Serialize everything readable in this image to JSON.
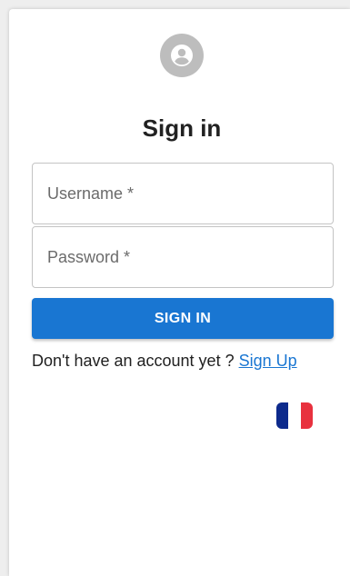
{
  "form": {
    "title": "Sign in",
    "username_placeholder": "Username *",
    "password_placeholder": "Password *",
    "submit_label": "SIGN IN",
    "signup_prompt": "Don't have an account yet ? ",
    "signup_link": "Sign Up"
  },
  "language": {
    "flag_icon": "france-flag-icon",
    "colors": [
      "#0d2a8c",
      "#ffffff",
      "#e8313e"
    ]
  },
  "colors": {
    "primary": "#1976d2",
    "avatar_bg": "#bdbdbd"
  }
}
